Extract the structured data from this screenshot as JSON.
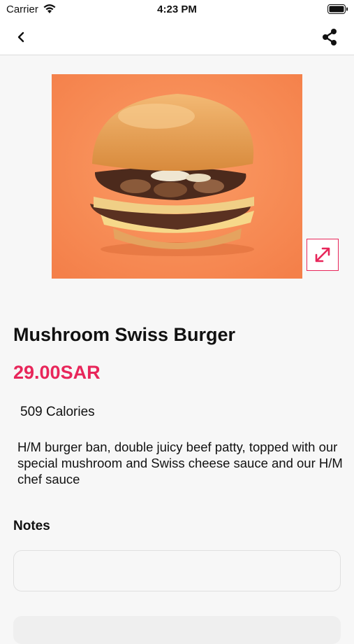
{
  "status_bar": {
    "carrier": "Carrier",
    "time": "4:23 PM"
  },
  "nav": {
    "back_icon": "chevron-left-icon",
    "share_icon": "share-icon"
  },
  "product": {
    "image_icon": "burger-image",
    "expand_icon": "expand-icon",
    "name": "Mushroom Swiss Burger",
    "price": "29.00SAR",
    "calories": "509 Calories",
    "description": "H/M burger ban, double juicy beef patty, topped with our special mushroom and Swiss cheese sauce and our H/M chef sauce"
  },
  "notes": {
    "label": "Notes",
    "value": "",
    "placeholder": ""
  },
  "colors": {
    "accent": "#e8265a",
    "image_background": "#f88c54",
    "page_background": "#f7f7f7"
  }
}
